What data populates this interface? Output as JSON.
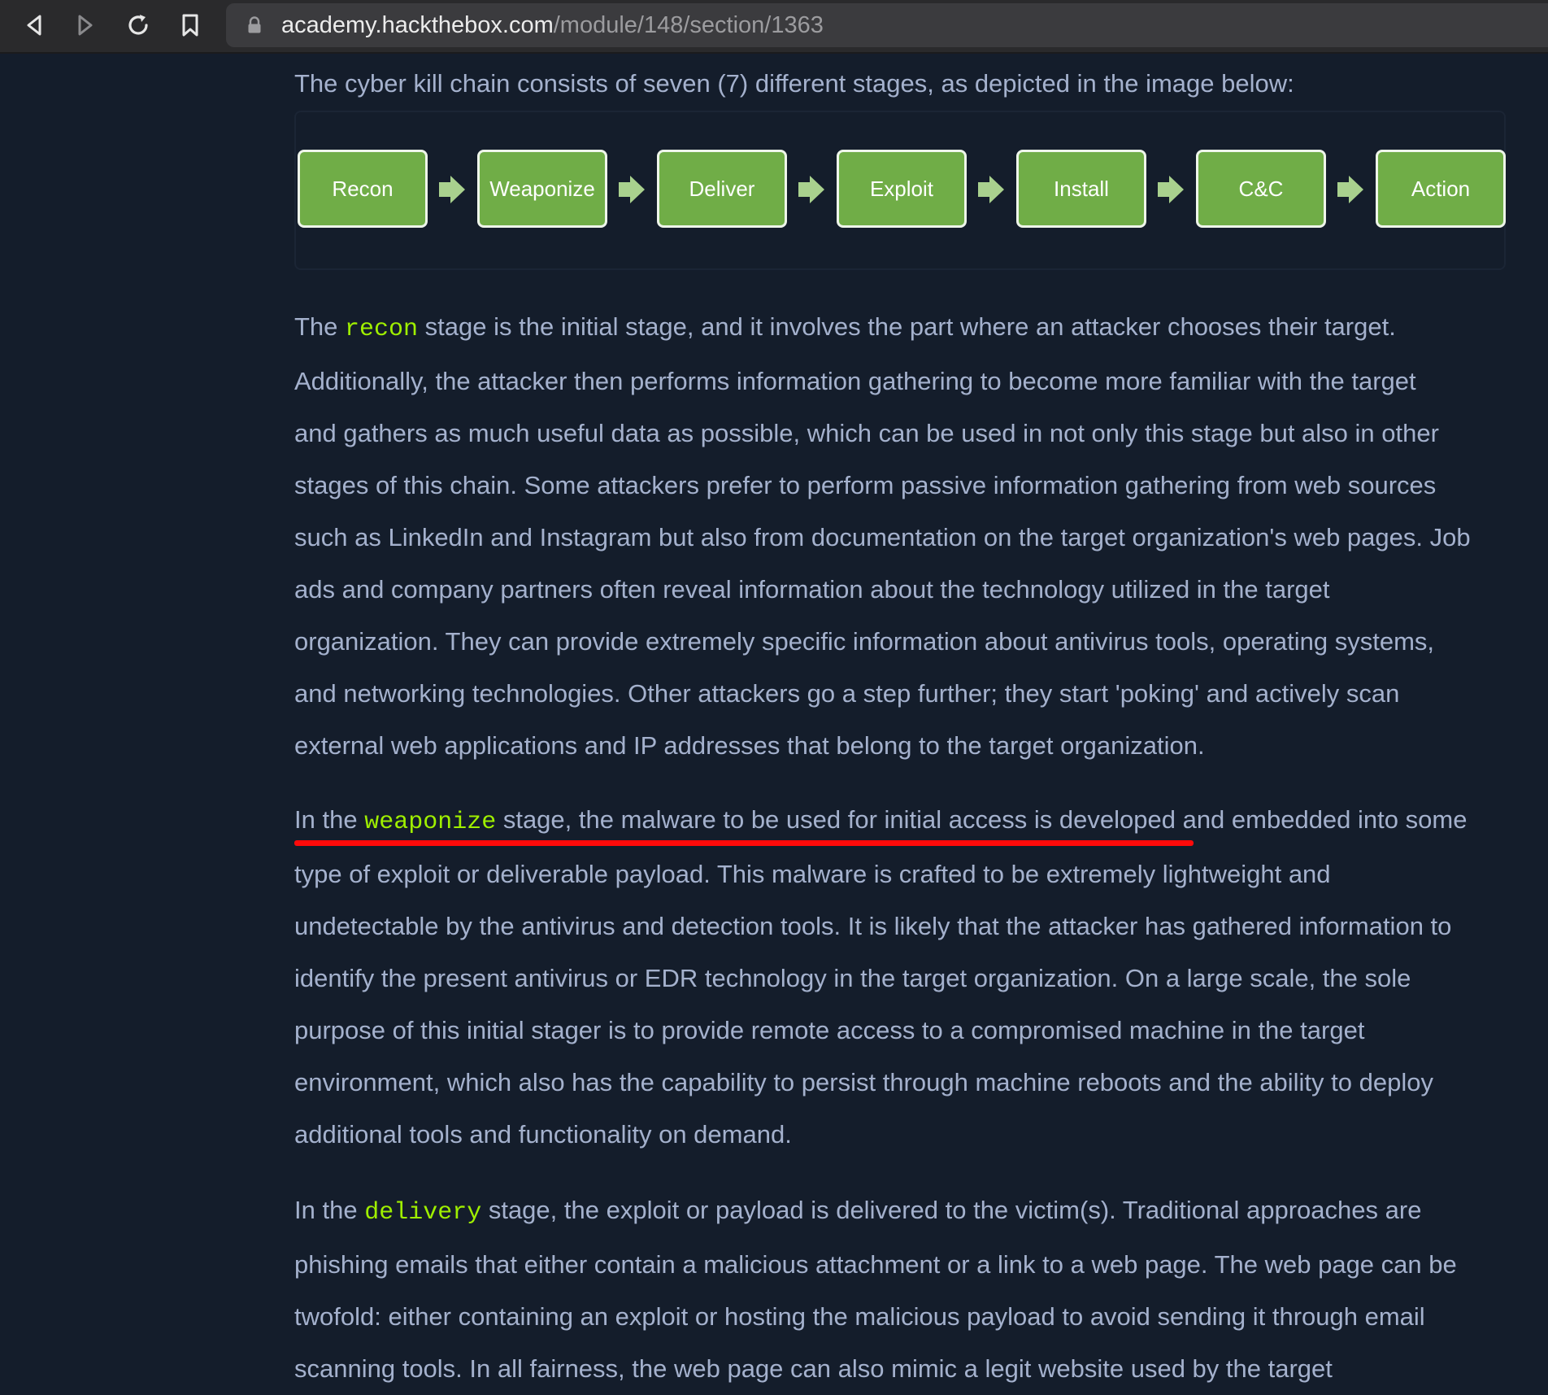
{
  "browser": {
    "url_domain": "academy.hackthebox.com",
    "url_path": "/module/148/section/1363"
  },
  "intro": "The cyber kill chain consists of seven (7) different stages, as depicted in the image below:",
  "stages": [
    "Recon",
    "Weaponize",
    "Deliver",
    "Exploit",
    "Install",
    "C&C",
    "Action"
  ],
  "colors": {
    "stage_fill": "#70ad47",
    "stage_arrow": "#a9d18e",
    "keyword": "#9fef00",
    "annotation_underline": "#ff0a0a",
    "page_background": "#141d2b",
    "text": "#a4b1cd"
  },
  "paragraphs": {
    "recon": {
      "l1_pre": "The ",
      "l1_kw": "recon",
      "l1_post": " stage is the initial stage, and it involves the part where an attacker chooses their target.",
      "l2": "Additionally, the attacker then performs information gathering to become more familiar with the target",
      "l3": "and gathers as much useful data as possible, which can be used in not only this stage but also in other",
      "l4": "stages of this chain. Some attackers prefer to perform passive information gathering from web sources",
      "l5": "such as LinkedIn and Instagram but also from documentation on the target organization's web pages. Job",
      "l6": "ads and company partners often reveal information about the technology utilized in the target",
      "l7": "organization. They can provide extremely specific information about antivirus tools, operating systems,",
      "l8": "and networking technologies. Other attackers go a step further; they start 'poking' and actively scan",
      "l9": "external web applications and IP addresses that belong to the target organization."
    },
    "weaponize": {
      "l1_pre": "In the ",
      "l1_kw": "weaponize",
      "l1_post": " stage, the malware to be used for initial access is developed and embedded into some",
      "l2": "type of exploit or deliverable payload. This malware is crafted to be extremely lightweight and",
      "l3": "undetectable by the antivirus and detection tools. It is likely that the attacker has gathered information to",
      "l4": "identify the present antivirus or EDR technology in the target organization. On a large scale, the sole",
      "l5": "purpose of this initial stager is to provide remote access to a compromised machine in the target",
      "l6": "environment, which also has the capability to persist through machine reboots and the ability to deploy",
      "l7": "additional tools and functionality on demand."
    },
    "delivery": {
      "l1_pre": "In the ",
      "l1_kw": "delivery",
      "l1_post": " stage, the exploit or payload is delivered to the victim(s). Traditional approaches are",
      "l2": "phishing emails that either contain a malicious attachment or a link to a web page. The web page can be",
      "l3": "twofold: either containing an exploit or hosting the malicious payload to avoid sending it through email",
      "l4": "scanning tools. In all fairness, the web page can also mimic a legit website used by the target"
    }
  }
}
